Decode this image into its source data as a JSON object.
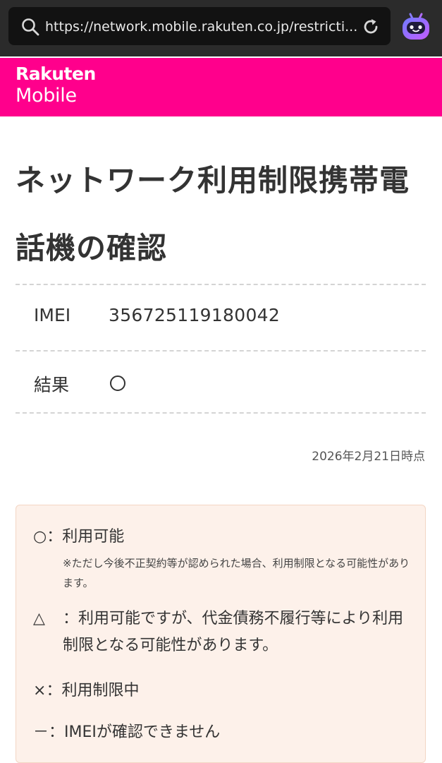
{
  "browser": {
    "url": "https://network.mobile.rakuten.co.jp/restricti..."
  },
  "header": {
    "logo_top": "Rakuten",
    "logo_bottom": "Mobile",
    "brand_color": "#ff008c"
  },
  "page": {
    "title": "ネットワーク利用制限携帯電話機の確認"
  },
  "results": {
    "imei_label": "IMEI",
    "imei_value": "356725119180042",
    "result_label": "結果",
    "result_symbol": "circle"
  },
  "timestamp": "2026年2月21日時点",
  "legend": {
    "circle_symbol": "○",
    "circle_text": "：利用可能",
    "circle_note": "※ただし今後不正契約等が認められた場合、利用制限となる可能性があります。",
    "triangle_symbol": "△",
    "triangle_text": "：利用可能ですが、代金債務不履行等により利用制限となる可能性があります。",
    "cross_symbol": "×",
    "cross_text": "：利用制限中",
    "dash_symbol": "－",
    "dash_text": "：IMEIが確認できません"
  }
}
